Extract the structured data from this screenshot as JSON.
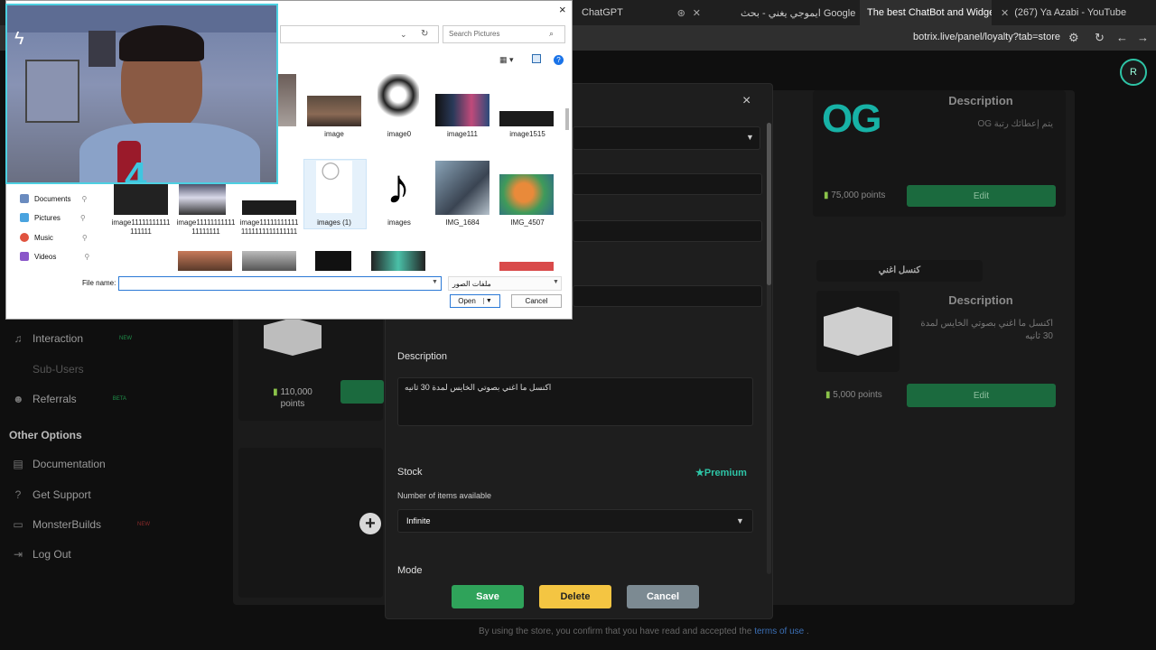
{
  "browser": {
    "tabs": [
      {
        "label": "ChatGPT",
        "active": false
      },
      {
        "label": "ايموجي يغني - بحث Google",
        "active": false
      },
      {
        "label": "The best ChatBot and Widgets",
        "active": true
      },
      {
        "label": "(267) Ya Azabi - YouTube",
        "active": false
      }
    ],
    "url": "botrix.live/panel/loyalty?tab=store"
  },
  "sidebar": {
    "items": [
      {
        "label": "Interaction",
        "badge": "NEW"
      },
      {
        "label": "Sub-Users",
        "badge": ""
      },
      {
        "label": "Referrals",
        "badge": "BETA"
      }
    ],
    "section_title": "Other Options",
    "options": [
      {
        "label": "Documentation"
      },
      {
        "label": "Get Support"
      },
      {
        "label": "MonsterBuilds",
        "badge": "NEW"
      },
      {
        "label": "Log Out"
      }
    ]
  },
  "store": {
    "left_card": {
      "points_value": "110,000",
      "points_unit": "points"
    },
    "card_og": {
      "logo_text": "OG",
      "description_title": "Description",
      "description": "يتم إعطائك رتبة OG",
      "points": "75,000 points",
      "edit_label": "Edit"
    },
    "card_cancel": {
      "title": "كنسل اغني",
      "description_title": "Description",
      "description": "اكنسل ما اغني بصوتي الخايس لمدة 30 ثانيه",
      "points": "5,000 points",
      "edit_label": "Edit"
    },
    "footer_text": "By using the store, you confirm that you have read and accepted the",
    "footer_link": "terms of use",
    "footer_end": "."
  },
  "modal": {
    "close_label": "×",
    "description_label": "Description",
    "description_value": "اكنسل ما اغني بصوتي الخايس لمدة 30 ثانيه",
    "stock_label": "Stock",
    "premium_label": "Premium",
    "items_label": "Number of items available",
    "stock_value": "Infinite",
    "mode_label": "Mode",
    "save_label": "Save",
    "delete_label": "Delete",
    "cancel_label": "Cancel",
    "colors": {
      "save": "#2fa35a",
      "delete": "#f4c542",
      "cancel": "#7c8a92",
      "premium": "#2ec4a6"
    }
  },
  "file_dialog": {
    "close_label": "×",
    "search_placeholder": "Search Pictures",
    "nav": [
      {
        "label": "Documents",
        "color": "#6a8bbf"
      },
      {
        "label": "Pictures",
        "color": "#4aa3df"
      },
      {
        "label": "Music",
        "color": "#e0533f"
      },
      {
        "label": "Videos",
        "color": "#8a56c9"
      }
    ],
    "files_row1": [
      {
        "name": "image"
      },
      {
        "name": "image0"
      },
      {
        "name": "image111"
      },
      {
        "name": "image1515"
      }
    ],
    "files_row2": [
      {
        "name": "image11111111111111111"
      },
      {
        "name": "image1111111111111111111"
      },
      {
        "name": "image111111111111111111111111111"
      },
      {
        "name": "images (1)"
      },
      {
        "name": "images"
      },
      {
        "name": "IMG_1684"
      },
      {
        "name": "IMG_4507"
      }
    ],
    "file_name_label": "File name:",
    "file_name_value": "",
    "filter_value": "ملفات الصور",
    "open_label": "Open",
    "cancel_label": "Cancel"
  },
  "webcam": {
    "overlay_text": "4"
  }
}
